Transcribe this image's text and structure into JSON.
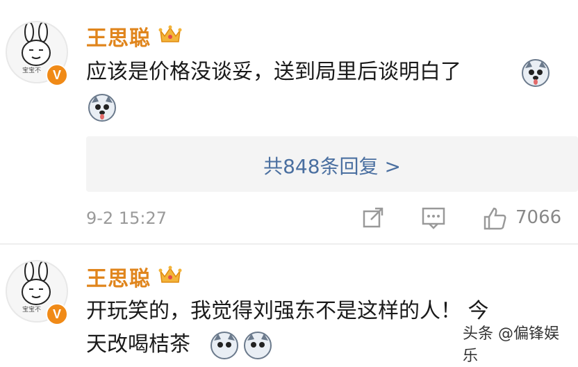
{
  "comments": [
    {
      "username": "王思聪",
      "avatar_caption": "宝宝不",
      "text_line1": "应该是价格没谈妥，送到局里后谈明白了",
      "reply_summary": "共848条回复 >",
      "timestamp": "9-2 15:27",
      "like_count": "7066"
    },
    {
      "username": "王思聪",
      "avatar_caption": "宝宝不",
      "text_line1": "开玩笑的，我觉得刘强东不是这样的人！ 今",
      "text_line2": "天改喝桔茶"
    }
  ],
  "icons": {
    "verified": "verified-v-badge",
    "crown": "crown-icon",
    "emoji": "husky-dog-emoji",
    "share": "share-icon",
    "comment": "comment-icon",
    "like": "thumbs-up-icon"
  },
  "watermark": "头条 @偏锋娱乐",
  "colors": {
    "username": "#e0851c",
    "reply_link": "#4a6fa0",
    "badge": "#f08a17"
  }
}
